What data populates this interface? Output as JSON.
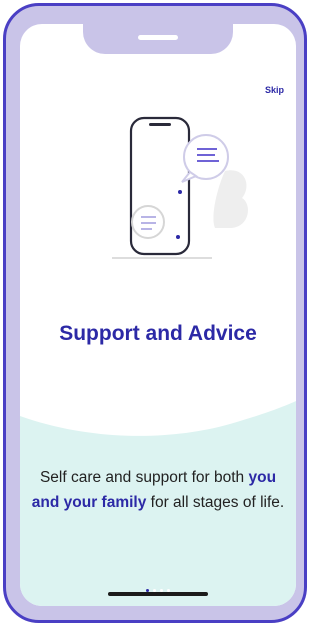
{
  "header": {
    "skip_label": "Skip"
  },
  "slide": {
    "title": "Support and Advice",
    "description_before": "Self care and support for both",
    "description_highlight": "you and your family",
    "description_after": "for all stages of life."
  },
  "pagination": {
    "total": 4,
    "active": 0
  },
  "colors": {
    "brand": "#2c29a6",
    "accent": "#6f63d6",
    "wave": "#dcf3f1",
    "frame": "#4a3fc4",
    "bezel": "#c9c4e8"
  }
}
